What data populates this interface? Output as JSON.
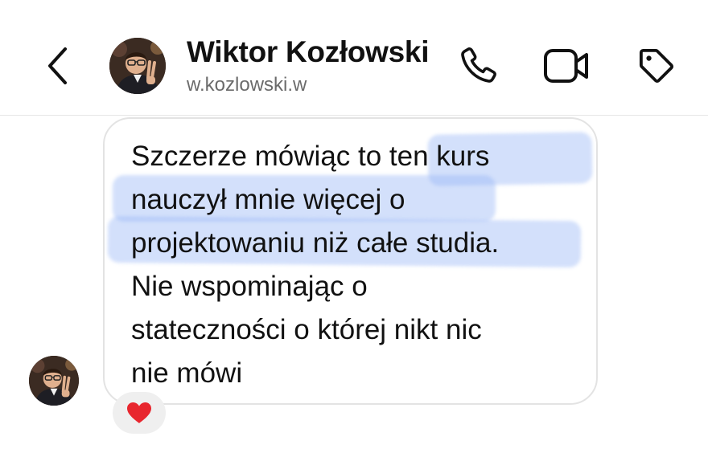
{
  "header": {
    "contact_name": "Wiktor Kozłowski",
    "contact_handle": "w.kozlowski.w",
    "icons": {
      "back": "chevron-left-icon",
      "call": "phone-icon",
      "video": "video-camera-icon",
      "tag": "tag-icon"
    }
  },
  "message": {
    "lines": [
      "Szczerze mówiąc to ten kurs",
      "nauczył mnie więcej o",
      "projektowaniu niż całe studia.",
      "Nie wspominając o",
      "stateczności o której nikt nic",
      "nie mówi"
    ],
    "highlight_color": "#96b4f5",
    "reaction_icon": "heart-icon",
    "reaction_color": "#e8262e"
  },
  "colors": {
    "bubble_border": "#e3e3e3",
    "handle_text": "#6b6b6b",
    "reaction_bg": "#efefef"
  }
}
